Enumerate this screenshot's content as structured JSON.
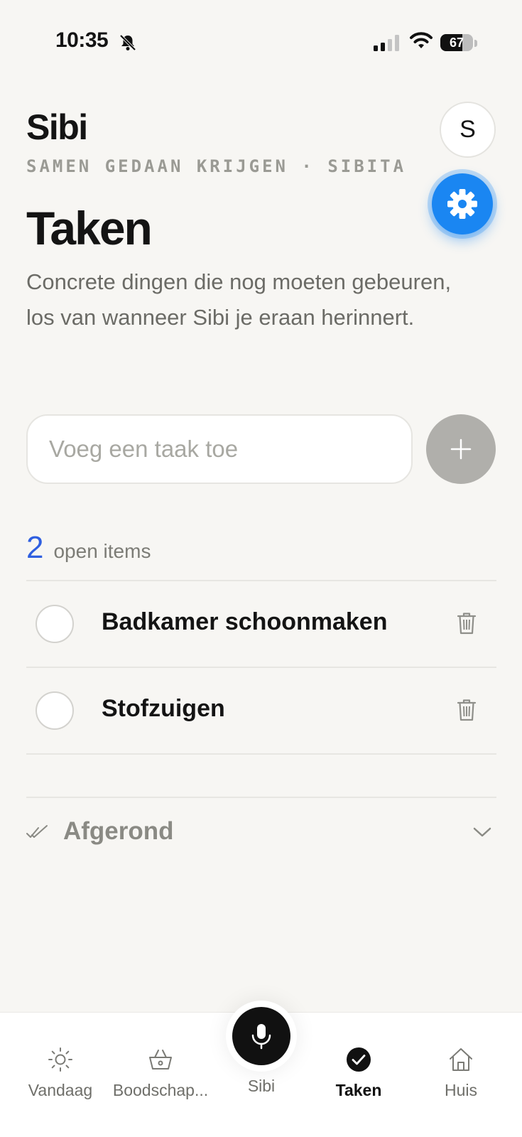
{
  "status_bar": {
    "time": "10:35",
    "battery": "67",
    "battery_level": 0.67
  },
  "header": {
    "app_title": "Sibi",
    "subtitle": "SAMEN GEDAAN KRIJGEN · SIBITA",
    "avatar_initial": "S"
  },
  "page": {
    "title": "Taken",
    "description": "Concrete dingen die nog moeten gebeuren, los van wanneer Sibi je eraan herinnert."
  },
  "input": {
    "placeholder": "Voeg een taak toe",
    "value": ""
  },
  "open_count": {
    "number": "2",
    "label": "open items"
  },
  "tasks": [
    {
      "title": "Badkamer schoonmaken",
      "done": false
    },
    {
      "title": "Stofzuigen",
      "done": false
    }
  ],
  "completed_section": {
    "label": "Afgerond",
    "expanded": false
  },
  "tab_bar": {
    "tabs": [
      {
        "label": "Vandaag",
        "icon": "sun-icon",
        "active": false
      },
      {
        "label": "Boodschap...",
        "icon": "basket-icon",
        "active": false
      },
      {
        "label": "Sibi",
        "icon": "microphone-icon",
        "active": false
      },
      {
        "label": "Taken",
        "icon": "checkmark-circle-icon",
        "active": true
      },
      {
        "label": "Huis",
        "icon": "house-icon",
        "active": false
      }
    ]
  },
  "colors": {
    "accent_blue": "#1a86f2",
    "count_blue": "#2f5fe0",
    "background": "#f7f6f3"
  }
}
